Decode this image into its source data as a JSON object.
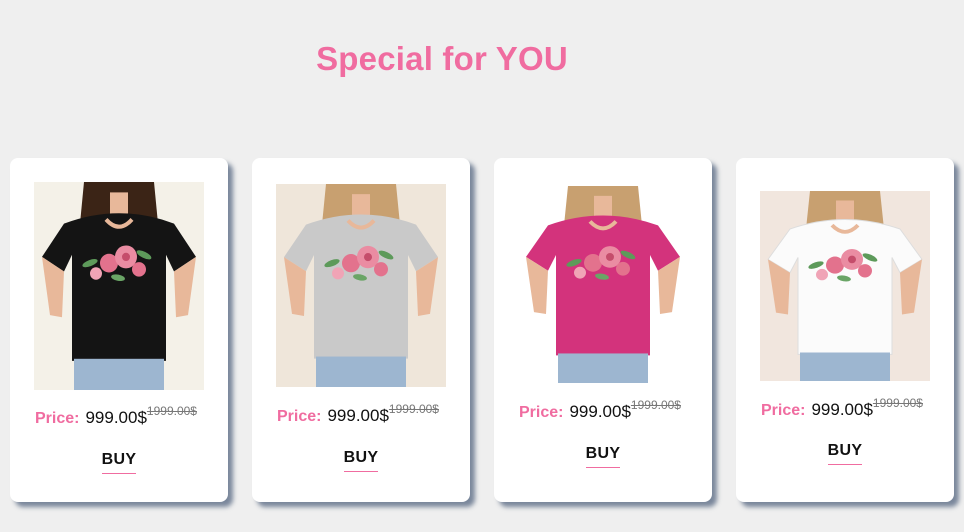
{
  "section": {
    "title": "Special for YOU"
  },
  "colors": {
    "accent": "#f06ca0",
    "background": "#efefef",
    "card": "#ffffff"
  },
  "products": [
    {
      "image_alt": "Woman in black t-shirt with pink flower print",
      "shirt_color": "#141414",
      "photo_bg": "#f4f1e8",
      "price_label": "Price:",
      "price": "999.00$",
      "old_price": "1999.00$",
      "buy_label": "BUY"
    },
    {
      "image_alt": "Woman in grey t-shirt with pink flower print",
      "shirt_color": "#c9c9c9",
      "photo_bg": "#efe6da",
      "price_label": "Price:",
      "price": "999.00$",
      "old_price": "1999.00$",
      "buy_label": "BUY"
    },
    {
      "image_alt": "Woman in magenta t-shirt with pink flower print",
      "shirt_color": "#d3337c",
      "photo_bg": "#ffffff",
      "price_label": "Price:",
      "price": "999.00$",
      "old_price": "1999.00$",
      "buy_label": "BUY"
    },
    {
      "image_alt": "Woman in white t-shirt with pink flower print",
      "shirt_color": "#fbfbfb",
      "photo_bg": "#f1e6de",
      "price_label": "Price:",
      "price": "999.00$",
      "old_price": "1999.00$",
      "buy_label": "BUY"
    }
  ]
}
